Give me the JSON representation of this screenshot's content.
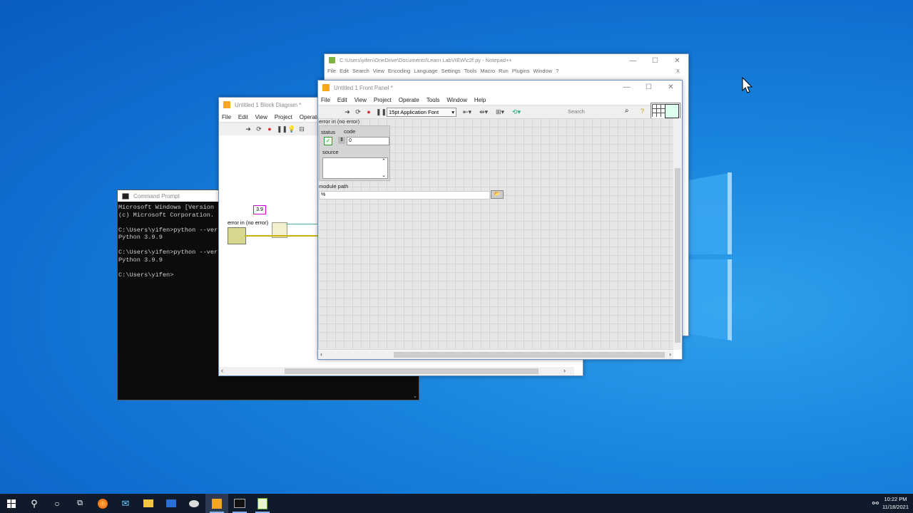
{
  "desktop": {
    "accent": "#1a86de"
  },
  "notepad": {
    "title": "C:\\Users\\yifen\\OneDrive\\Documents\\Learn LabVIEW\\c2f.py - Notepad++",
    "menu": [
      "File",
      "Edit",
      "Search",
      "View",
      "Encoding",
      "Language",
      "Settings",
      "Tools",
      "Macro",
      "Run",
      "Plugins",
      "Window",
      "?"
    ],
    "close_x": "X"
  },
  "block_diagram": {
    "title": "Untitled 1 Block Diagram *",
    "menu": [
      "File",
      "Edit",
      "View",
      "Project",
      "Operate"
    ],
    "constant_value": "3.9",
    "error_label": "error in (no error)"
  },
  "cmd": {
    "title": "Command Prompt",
    "lines": [
      "Microsoft Windows [Version",
      "(c) Microsoft Corporation.",
      "",
      "C:\\Users\\yifen>python --ver",
      "Python 3.9.9",
      "",
      "C:\\Users\\yifen>python --ver",
      "Python 3.9.9",
      "",
      "C:\\Users\\yifen>"
    ]
  },
  "front_panel": {
    "title": "Untitled 1 Front Panel *",
    "menu": [
      "File",
      "Edit",
      "View",
      "Project",
      "Operate",
      "Tools",
      "Window",
      "Help"
    ],
    "font_select": "15pt Application Font",
    "search_placeholder": "Search",
    "error_cluster_label": "error in (no error)",
    "status_label": "status",
    "code_label": "code",
    "code_value": "0",
    "source_label": "source",
    "module_path_label": "module path",
    "path_prefix": "%"
  },
  "taskbar": {
    "time": "10:22 PM",
    "date": "11/18/2021"
  }
}
